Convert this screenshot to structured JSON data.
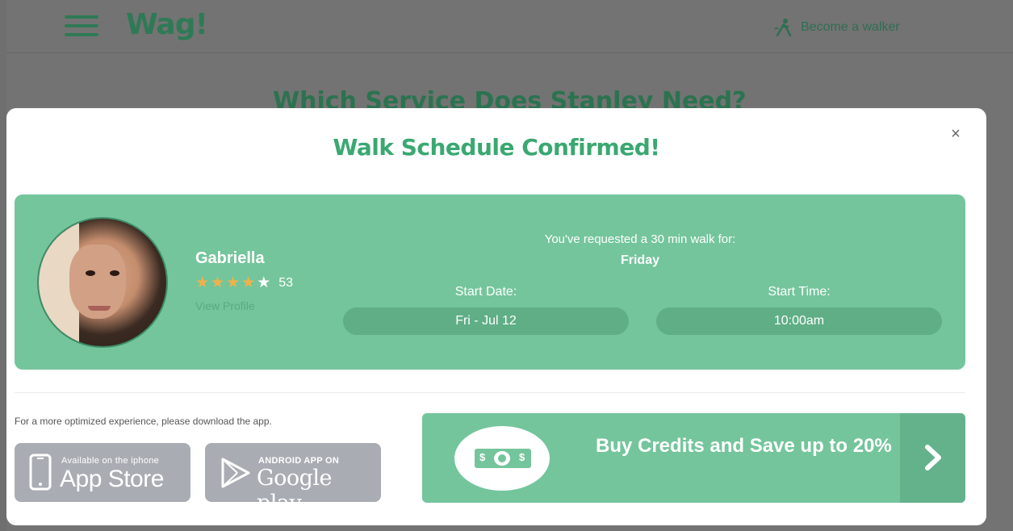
{
  "background": {
    "logo": "Wag!",
    "become_walker": "Become a walker",
    "heading": "Which Service Does Stanley Need?"
  },
  "modal": {
    "close": "×",
    "title": "Walk Schedule Confirmed!"
  },
  "walker": {
    "name": "Gabriella",
    "rating": 4,
    "rating_max": 5,
    "review_count": "53",
    "view_profile": "View Profile"
  },
  "request": {
    "text": "You've requested a 30 min walk for:",
    "day": "Friday",
    "start_date_label": "Start Date:",
    "start_date_value": "Fri - Jul 12",
    "start_time_label": "Start Time:",
    "start_time_value": "10:00am"
  },
  "download": {
    "text": "For a more optimized experience, please download the app.",
    "appstore_small": "Available on the iphone",
    "appstore_big": "App Store",
    "google_small": "ANDROID APP ON",
    "google_big": "Google play"
  },
  "credits": {
    "text": "Buy Credits and Save up to 20%",
    "bill_symbol": "$",
    "arrow_icon": "chevron-right-icon"
  },
  "colors": {
    "brand_green": "#74c59c",
    "title_green": "#3aa871",
    "star": "#f0b24a"
  }
}
